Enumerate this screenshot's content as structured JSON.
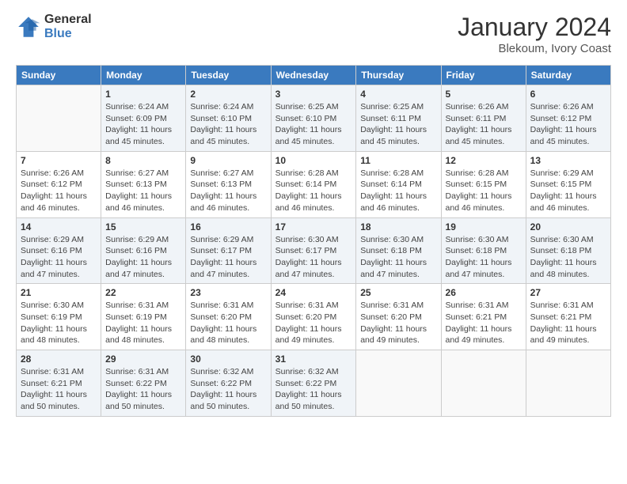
{
  "logo": {
    "general": "General",
    "blue": "Blue"
  },
  "header": {
    "month": "January 2024",
    "location": "Blekoum, Ivory Coast"
  },
  "weekdays": [
    "Sunday",
    "Monday",
    "Tuesday",
    "Wednesday",
    "Thursday",
    "Friday",
    "Saturday"
  ],
  "weeks": [
    [
      {
        "day": "",
        "info": ""
      },
      {
        "day": "1",
        "info": "Sunrise: 6:24 AM\nSunset: 6:09 PM\nDaylight: 11 hours\nand 45 minutes."
      },
      {
        "day": "2",
        "info": "Sunrise: 6:24 AM\nSunset: 6:10 PM\nDaylight: 11 hours\nand 45 minutes."
      },
      {
        "day": "3",
        "info": "Sunrise: 6:25 AM\nSunset: 6:10 PM\nDaylight: 11 hours\nand 45 minutes."
      },
      {
        "day": "4",
        "info": "Sunrise: 6:25 AM\nSunset: 6:11 PM\nDaylight: 11 hours\nand 45 minutes."
      },
      {
        "day": "5",
        "info": "Sunrise: 6:26 AM\nSunset: 6:11 PM\nDaylight: 11 hours\nand 45 minutes."
      },
      {
        "day": "6",
        "info": "Sunrise: 6:26 AM\nSunset: 6:12 PM\nDaylight: 11 hours\nand 45 minutes."
      }
    ],
    [
      {
        "day": "7",
        "info": "Sunrise: 6:26 AM\nSunset: 6:12 PM\nDaylight: 11 hours\nand 46 minutes."
      },
      {
        "day": "8",
        "info": "Sunrise: 6:27 AM\nSunset: 6:13 PM\nDaylight: 11 hours\nand 46 minutes."
      },
      {
        "day": "9",
        "info": "Sunrise: 6:27 AM\nSunset: 6:13 PM\nDaylight: 11 hours\nand 46 minutes."
      },
      {
        "day": "10",
        "info": "Sunrise: 6:28 AM\nSunset: 6:14 PM\nDaylight: 11 hours\nand 46 minutes."
      },
      {
        "day": "11",
        "info": "Sunrise: 6:28 AM\nSunset: 6:14 PM\nDaylight: 11 hours\nand 46 minutes."
      },
      {
        "day": "12",
        "info": "Sunrise: 6:28 AM\nSunset: 6:15 PM\nDaylight: 11 hours\nand 46 minutes."
      },
      {
        "day": "13",
        "info": "Sunrise: 6:29 AM\nSunset: 6:15 PM\nDaylight: 11 hours\nand 46 minutes."
      }
    ],
    [
      {
        "day": "14",
        "info": "Sunrise: 6:29 AM\nSunset: 6:16 PM\nDaylight: 11 hours\nand 47 minutes."
      },
      {
        "day": "15",
        "info": "Sunrise: 6:29 AM\nSunset: 6:16 PM\nDaylight: 11 hours\nand 47 minutes."
      },
      {
        "day": "16",
        "info": "Sunrise: 6:29 AM\nSunset: 6:17 PM\nDaylight: 11 hours\nand 47 minutes."
      },
      {
        "day": "17",
        "info": "Sunrise: 6:30 AM\nSunset: 6:17 PM\nDaylight: 11 hours\nand 47 minutes."
      },
      {
        "day": "18",
        "info": "Sunrise: 6:30 AM\nSunset: 6:18 PM\nDaylight: 11 hours\nand 47 minutes."
      },
      {
        "day": "19",
        "info": "Sunrise: 6:30 AM\nSunset: 6:18 PM\nDaylight: 11 hours\nand 47 minutes."
      },
      {
        "day": "20",
        "info": "Sunrise: 6:30 AM\nSunset: 6:18 PM\nDaylight: 11 hours\nand 48 minutes."
      }
    ],
    [
      {
        "day": "21",
        "info": "Sunrise: 6:30 AM\nSunset: 6:19 PM\nDaylight: 11 hours\nand 48 minutes."
      },
      {
        "day": "22",
        "info": "Sunrise: 6:31 AM\nSunset: 6:19 PM\nDaylight: 11 hours\nand 48 minutes."
      },
      {
        "day": "23",
        "info": "Sunrise: 6:31 AM\nSunset: 6:20 PM\nDaylight: 11 hours\nand 48 minutes."
      },
      {
        "day": "24",
        "info": "Sunrise: 6:31 AM\nSunset: 6:20 PM\nDaylight: 11 hours\nand 49 minutes."
      },
      {
        "day": "25",
        "info": "Sunrise: 6:31 AM\nSunset: 6:20 PM\nDaylight: 11 hours\nand 49 minutes."
      },
      {
        "day": "26",
        "info": "Sunrise: 6:31 AM\nSunset: 6:21 PM\nDaylight: 11 hours\nand 49 minutes."
      },
      {
        "day": "27",
        "info": "Sunrise: 6:31 AM\nSunset: 6:21 PM\nDaylight: 11 hours\nand 49 minutes."
      }
    ],
    [
      {
        "day": "28",
        "info": "Sunrise: 6:31 AM\nSunset: 6:21 PM\nDaylight: 11 hours\nand 50 minutes."
      },
      {
        "day": "29",
        "info": "Sunrise: 6:31 AM\nSunset: 6:22 PM\nDaylight: 11 hours\nand 50 minutes."
      },
      {
        "day": "30",
        "info": "Sunrise: 6:32 AM\nSunset: 6:22 PM\nDaylight: 11 hours\nand 50 minutes."
      },
      {
        "day": "31",
        "info": "Sunrise: 6:32 AM\nSunset: 6:22 PM\nDaylight: 11 hours\nand 50 minutes."
      },
      {
        "day": "",
        "info": ""
      },
      {
        "day": "",
        "info": ""
      },
      {
        "day": "",
        "info": ""
      }
    ]
  ]
}
